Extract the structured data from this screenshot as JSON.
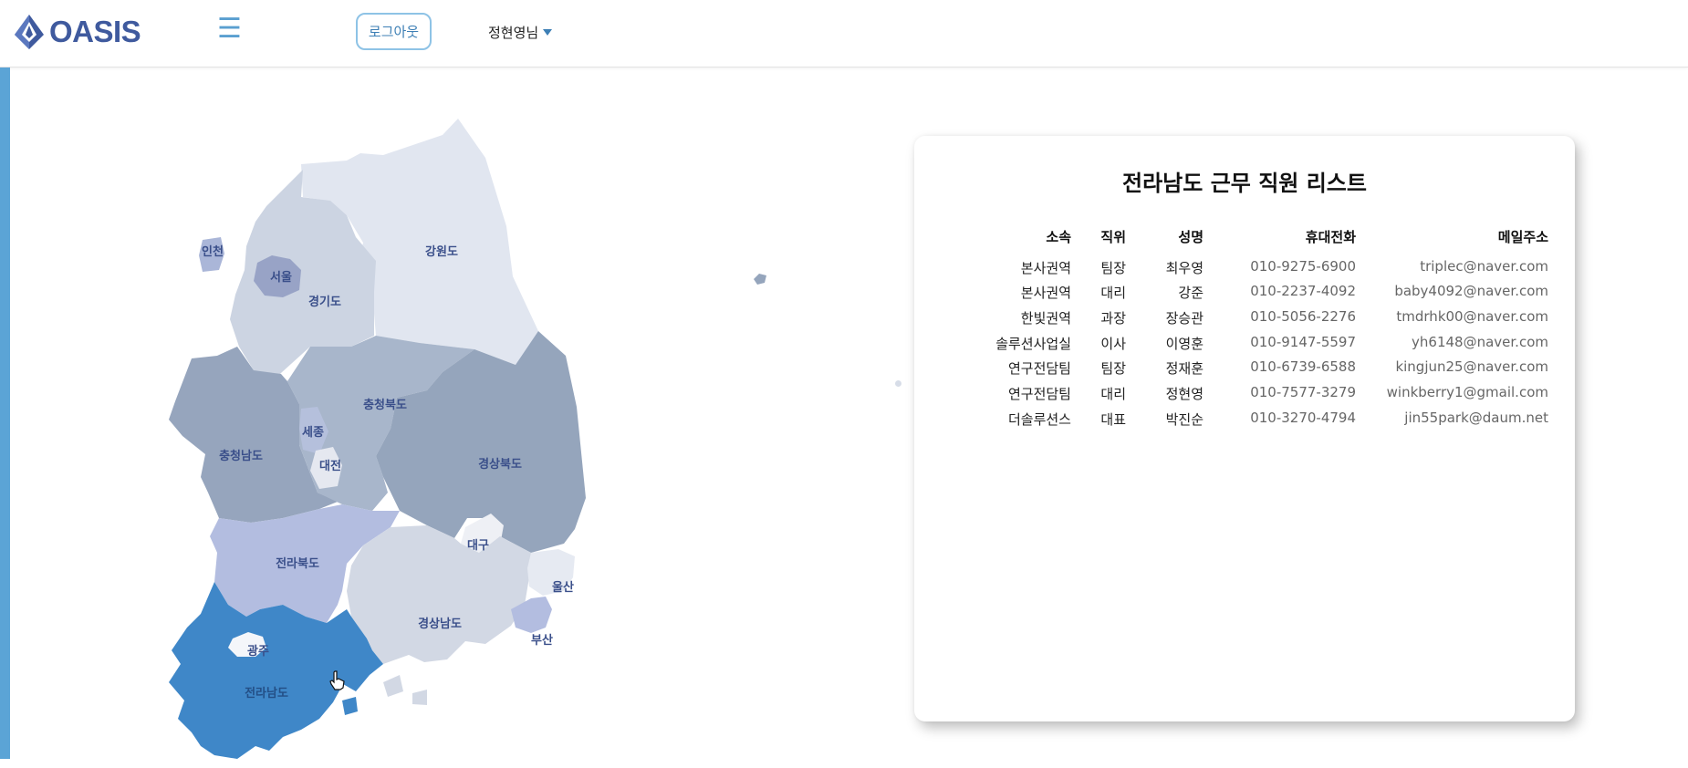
{
  "app": {
    "logo_text": "OASIS",
    "menu_icon": "hamburger-menu-icon",
    "logout_label": "로그아웃",
    "user_label": "정현영님",
    "user_caret_icon": "caret-down-icon",
    "accent_color": "#5ba4d6",
    "brand_color": "#3f5a9e"
  },
  "map": {
    "selected_region": "전라남도",
    "selected_color": "#3f87c8",
    "regions": [
      {
        "id": "incheon",
        "label": "인천",
        "color": "#aab6d8"
      },
      {
        "id": "seoul",
        "label": "서울",
        "color": "#98a3c6"
      },
      {
        "id": "gyeonggi",
        "label": "경기도",
        "color": "#ccd4e2"
      },
      {
        "id": "gangwon",
        "label": "강원도",
        "color": "#e1e6f0"
      },
      {
        "id": "chungbuk",
        "label": "충청북도",
        "color": "#a8b6cb"
      },
      {
        "id": "chungnam",
        "label": "충청남도",
        "color": "#96a5bd"
      },
      {
        "id": "sejong",
        "label": "세종",
        "color": "#b5c0dc"
      },
      {
        "id": "daejeon",
        "label": "대전",
        "color": "#e5e8f0"
      },
      {
        "id": "gyeongbuk",
        "label": "경상북도",
        "color": "#95a5bc"
      },
      {
        "id": "daegu",
        "label": "대구",
        "color": "#eef0f5"
      },
      {
        "id": "jeonbuk",
        "label": "전라북도",
        "color": "#b3bde0"
      },
      {
        "id": "gyeongnam",
        "label": "경상남도",
        "color": "#d2d8e4"
      },
      {
        "id": "ulsan",
        "label": "울산",
        "color": "#e6eaf2"
      },
      {
        "id": "busan",
        "label": "부산",
        "color": "#b3bde0"
      },
      {
        "id": "jeonnam",
        "label": "전라남도",
        "color": "#3f87c8"
      },
      {
        "id": "gwangju",
        "label": "광주",
        "color": "#f4f6fa"
      }
    ]
  },
  "list": {
    "title": "전라남도 근무 직원 리스트",
    "headers": [
      "소속",
      "직위",
      "성명",
      "휴대전화",
      "메일주소"
    ],
    "rows": [
      [
        "본사권역",
        "팀장",
        "최우영",
        "010-9275-6900",
        "triplec@naver.com"
      ],
      [
        "본사권역",
        "대리",
        "강준",
        "010-2237-4092",
        "baby4092@naver.com"
      ],
      [
        "한빛권역",
        "과장",
        "장승관",
        "010-5056-2276",
        "tmdrhk00@naver.com"
      ],
      [
        "솔루션사업실",
        "이사",
        "이영훈",
        "010-9147-5597",
        "yh6148@naver.com"
      ],
      [
        "연구전담팀",
        "팀장",
        "정재훈",
        "010-6739-6588",
        "kingjun25@naver.com"
      ],
      [
        "연구전담팀",
        "대리",
        "정현영",
        "010-7577-3279",
        "winkberry1@gmail.com"
      ],
      [
        "더솔루션스",
        "대표",
        "박진순",
        "010-3270-4794",
        "jin55park@daum.net"
      ]
    ]
  }
}
